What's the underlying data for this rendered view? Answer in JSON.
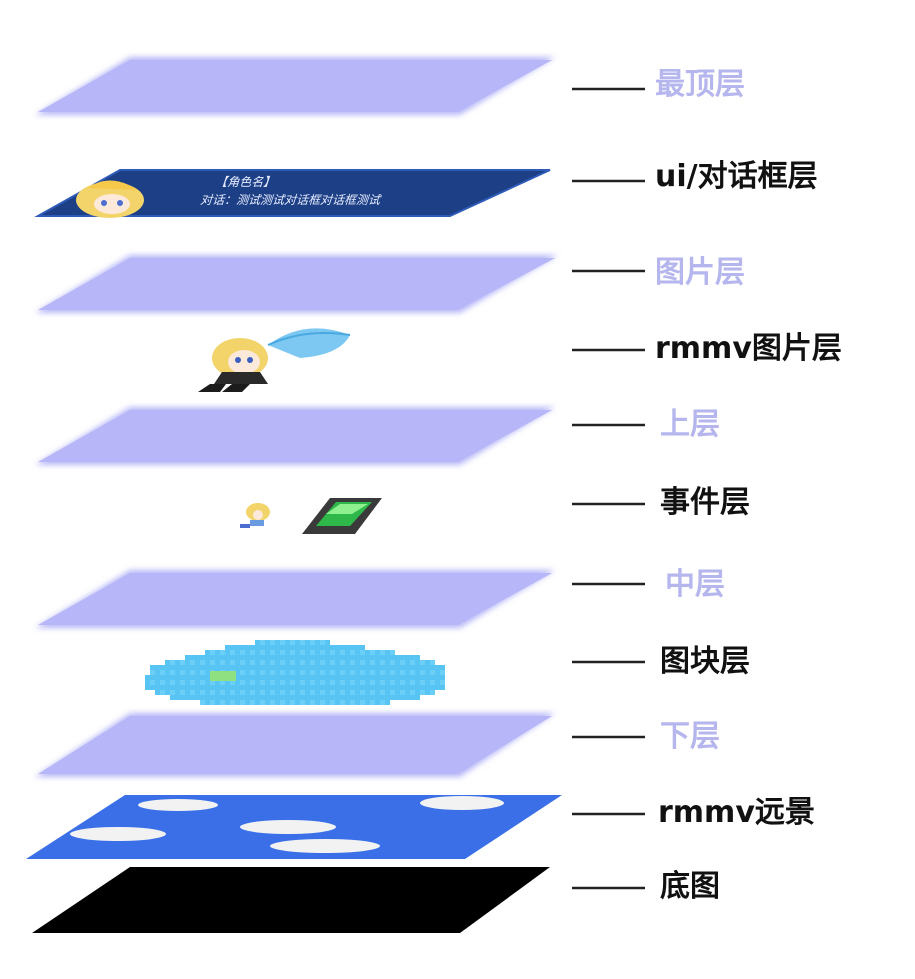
{
  "layers": [
    {
      "id": "top",
      "label": "最顶层",
      "style": "light"
    },
    {
      "id": "ui",
      "label": "ui/对话框层",
      "style": "dark"
    },
    {
      "id": "picture",
      "label": "图片层",
      "style": "light"
    },
    {
      "id": "rmmv-picture",
      "label": "rmmv图片层",
      "style": "dark"
    },
    {
      "id": "upper",
      "label": "上层",
      "style": "light"
    },
    {
      "id": "event",
      "label": "事件层",
      "style": "dark"
    },
    {
      "id": "middle",
      "label": "中层",
      "style": "light"
    },
    {
      "id": "tile",
      "label": "图块层",
      "style": "dark"
    },
    {
      "id": "lower",
      "label": "下层",
      "style": "light"
    },
    {
      "id": "rmmv-parallax",
      "label": "rmmv远景",
      "style": "dark"
    },
    {
      "id": "base",
      "label": "底图",
      "style": "dark"
    }
  ],
  "dialog": {
    "name_line": "【角色名】",
    "text_line": "对话：测试测试对话框对话框测试"
  },
  "colors": {
    "light_plane": "#b8b8f8",
    "light_label": "#b6b6ee",
    "dark_label": "#111111",
    "dialog_bg": "#1d3f86",
    "sky_blue": "#3a6fe8",
    "cloud_pixel": "#58c4f4",
    "base_black": "#000000"
  }
}
